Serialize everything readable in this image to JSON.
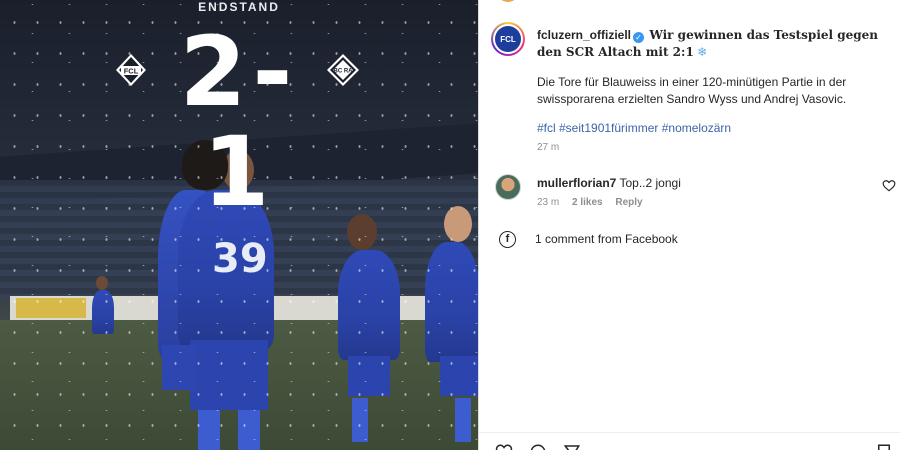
{
  "photo": {
    "header": "ENDSTAND",
    "score": "2-1",
    "jersey_number": "39",
    "home_logo": "FCL",
    "away_logo": "BC RA"
  },
  "post": {
    "username": "fcluzern_offiziell",
    "verified": true,
    "title": "Wir gewinnen das Testspiel gegen den SCR Altach mit 2:1",
    "title_emoji": "❄",
    "body": "Die Tore für Blauweiss in einer 120-minütigen Partie in der swissporarena erzielten Sandro Wyss und Andrej Vasovic.",
    "hashtags": "#fcl #seit1901fürimmer #nomelozärn",
    "time": "27 m"
  },
  "comment": {
    "username": "mullerflorian7",
    "text": "Top..2 jongi",
    "time": "23 m",
    "likes": "2 likes",
    "reply": "Reply"
  },
  "facebook": {
    "icon": "f",
    "text": "1 comment from Facebook"
  },
  "colors": {
    "accent_blue": "#3897f0",
    "hashtag": "#3b64a8",
    "meta_gray": "#8e8e8e"
  }
}
